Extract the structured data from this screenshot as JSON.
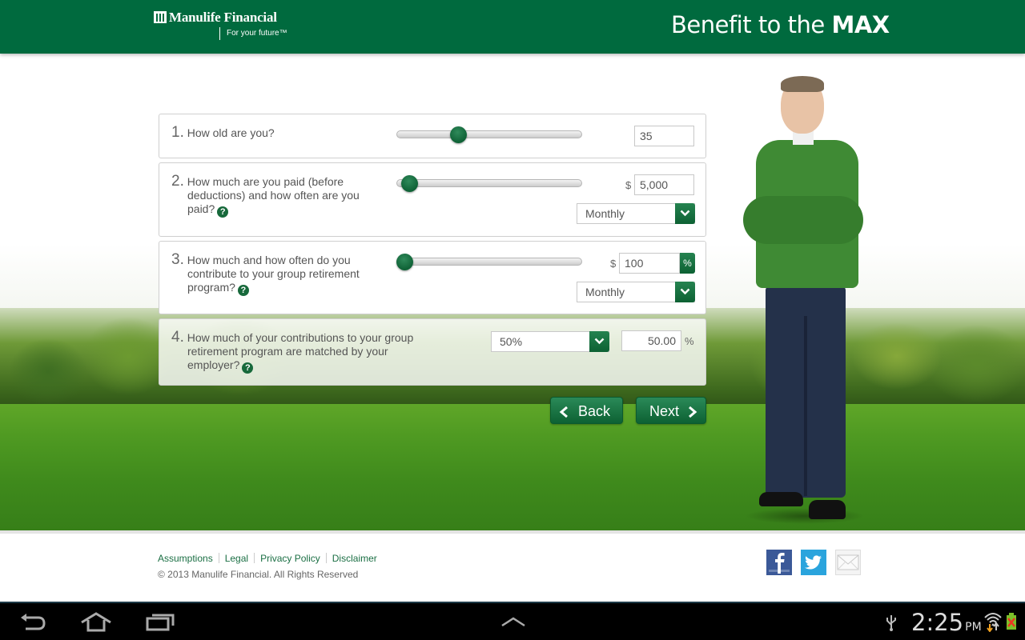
{
  "header": {
    "brand_name": "Manulife Financial",
    "brand_tagline": "For your future™",
    "title_regular": "Benefit to the ",
    "title_bold": "MAX",
    "brand_color": "#006a3e"
  },
  "questions": [
    {
      "number": "1.",
      "lines": [
        "How old are you?"
      ],
      "help": false,
      "slider_value_fraction": 0.32,
      "input_value": "35"
    },
    {
      "number": "2.",
      "lines": [
        "How much are you paid (before",
        "deductions) and how often are you",
        "paid?"
      ],
      "help": true,
      "slider_value_fraction": 0.03,
      "currency_symbol": "$",
      "input_value": "5,000",
      "frequency_selected": "Monthly"
    },
    {
      "number": "3.",
      "lines": [
        "How much and how often do you",
        "contribute to your group retirement",
        "program?"
      ],
      "help": true,
      "slider_value_fraction": 0.0,
      "currency_symbol": "$",
      "input_value": "100",
      "toggle_label": "%",
      "frequency_selected": "Monthly"
    },
    {
      "number": "4.",
      "lines": [
        "How much of your contributions to your group",
        "retirement program are matched by your",
        "employer?"
      ],
      "help": true,
      "match_selected": "50%",
      "input_value": "50.00",
      "unit": "%"
    }
  ],
  "help_icon_glyph": "?",
  "buttons": {
    "back": "Back",
    "next": "Next"
  },
  "footer": {
    "links": [
      "Assumptions",
      "Legal",
      "Privacy Policy",
      "Disclaimer"
    ],
    "copyright": "© 2013 Manulife Financial. All Rights Reserved",
    "social": [
      "facebook-icon",
      "twitter-icon",
      "email-icon"
    ]
  },
  "system_bar": {
    "time": "2:25",
    "ampm": "PM",
    "icons": [
      "back-icon",
      "home-icon",
      "recent-apps-icon",
      "up-chevron-icon",
      "usb-icon",
      "wifi-icon",
      "battery-icon"
    ]
  }
}
